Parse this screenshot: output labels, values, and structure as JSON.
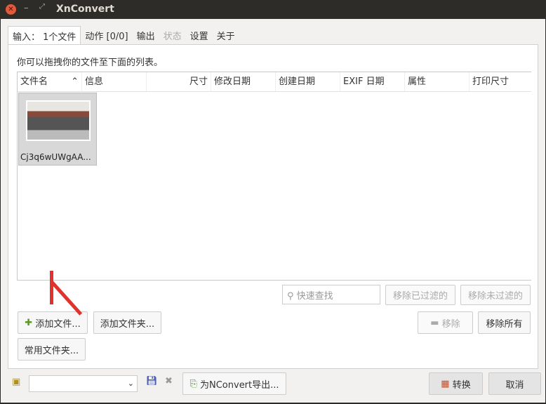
{
  "window": {
    "title": "XnConvert"
  },
  "tabs": [
    {
      "label": "输入： 1个文件"
    },
    {
      "label": "动作 [0/0]"
    },
    {
      "label": "输出"
    },
    {
      "label": "状态"
    },
    {
      "label": "设置"
    },
    {
      "label": "关于"
    }
  ],
  "input": {
    "hint": "你可以拖拽你的文件至下面的列表。",
    "columns": [
      "文件名",
      "信息",
      "尺寸",
      "修改日期",
      "创建日期",
      "EXIF 日期",
      "属性",
      "打印尺寸"
    ],
    "files": [
      {
        "name": "Cj3q6wUWgAA..."
      }
    ],
    "search_placeholder": "快速查找",
    "buttons": {
      "remove_filtered": "移除已过滤的",
      "remove_unfiltered": "移除未过滤的",
      "add_files": "添加文件...",
      "add_folder": "添加文件夹...",
      "remove": "移除",
      "remove_all": "移除所有",
      "common_folders": "常用文件夹..."
    }
  },
  "footer": {
    "preset_value": "",
    "export_label": "为NConvert导出...",
    "convert": "转换",
    "cancel": "取消"
  }
}
